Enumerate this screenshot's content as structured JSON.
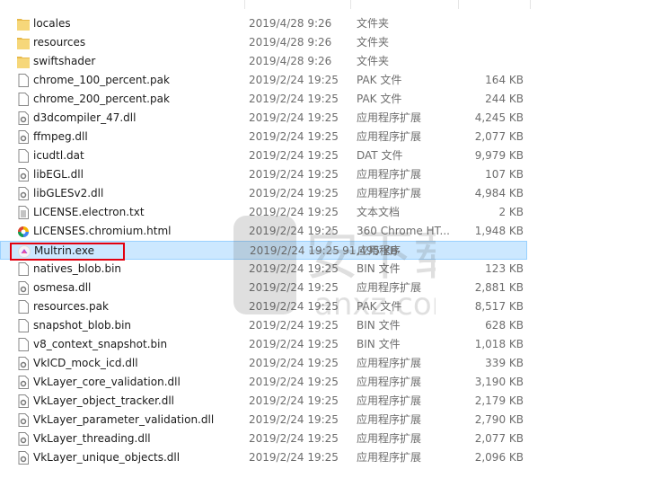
{
  "colors": {
    "selection": "#cce8ff",
    "highlight": "#e3000f",
    "folder": "#f6d77a"
  },
  "files": [
    {
      "name": "locales",
      "date": "2019/4/28 9:26",
      "type": "文件夹",
      "size": "",
      "icon": "folder-icon"
    },
    {
      "name": "resources",
      "date": "2019/4/28 9:26",
      "type": "文件夹",
      "size": "",
      "icon": "folder-icon"
    },
    {
      "name": "swiftshader",
      "date": "2019/4/28 9:26",
      "type": "文件夹",
      "size": "",
      "icon": "folder-icon"
    },
    {
      "name": "chrome_100_percent.pak",
      "date": "2019/2/24 19:25",
      "type": "PAK 文件",
      "size": "164 KB",
      "icon": "file-icon"
    },
    {
      "name": "chrome_200_percent.pak",
      "date": "2019/2/24 19:25",
      "type": "PAK 文件",
      "size": "244 KB",
      "icon": "file-icon"
    },
    {
      "name": "d3dcompiler_47.dll",
      "date": "2019/2/24 19:25",
      "type": "应用程序扩展",
      "size": "4,245 KB",
      "icon": "dll-icon"
    },
    {
      "name": "ffmpeg.dll",
      "date": "2019/2/24 19:25",
      "type": "应用程序扩展",
      "size": "2,077 KB",
      "icon": "dll-icon"
    },
    {
      "name": "icudtl.dat",
      "date": "2019/2/24 19:25",
      "type": "DAT 文件",
      "size": "9,979 KB",
      "icon": "file-icon"
    },
    {
      "name": "libEGL.dll",
      "date": "2019/2/24 19:25",
      "type": "应用程序扩展",
      "size": "107 KB",
      "icon": "dll-icon"
    },
    {
      "name": "libGLESv2.dll",
      "date": "2019/2/24 19:25",
      "type": "应用程序扩展",
      "size": "4,984 KB",
      "icon": "dll-icon"
    },
    {
      "name": "LICENSE.electron.txt",
      "date": "2019/2/24 19:25",
      "type": "文本文档",
      "size": "2 KB",
      "icon": "text-file-icon"
    },
    {
      "name": "LICENSES.chromium.html",
      "date": "2019/2/24 19:25",
      "type": "360 Chrome HT...",
      "size": "1,948 KB",
      "icon": "browser-html-icon"
    },
    {
      "name": "Multrin.exe",
      "date": "2019/2/24 19:25",
      "type": "应用程序",
      "size": "91,495 KB",
      "icon": "app-exe-icon",
      "selected": true
    },
    {
      "name": "natives_blob.bin",
      "date": "2019/2/24 19:25",
      "type": "BIN 文件",
      "size": "123 KB",
      "icon": "file-icon"
    },
    {
      "name": "osmesa.dll",
      "date": "2019/2/24 19:25",
      "type": "应用程序扩展",
      "size": "2,881 KB",
      "icon": "dll-icon"
    },
    {
      "name": "resources.pak",
      "date": "2019/2/24 19:25",
      "type": "PAK 文件",
      "size": "8,517 KB",
      "icon": "file-icon"
    },
    {
      "name": "snapshot_blob.bin",
      "date": "2019/2/24 19:25",
      "type": "BIN 文件",
      "size": "628 KB",
      "icon": "file-icon"
    },
    {
      "name": "v8_context_snapshot.bin",
      "date": "2019/2/24 19:25",
      "type": "BIN 文件",
      "size": "1,018 KB",
      "icon": "file-icon"
    },
    {
      "name": "VkICD_mock_icd.dll",
      "date": "2019/2/24 19:25",
      "type": "应用程序扩展",
      "size": "339 KB",
      "icon": "dll-icon"
    },
    {
      "name": "VkLayer_core_validation.dll",
      "date": "2019/2/24 19:25",
      "type": "应用程序扩展",
      "size": "3,190 KB",
      "icon": "dll-icon"
    },
    {
      "name": "VkLayer_object_tracker.dll",
      "date": "2019/2/24 19:25",
      "type": "应用程序扩展",
      "size": "2,179 KB",
      "icon": "dll-icon"
    },
    {
      "name": "VkLayer_parameter_validation.dll",
      "date": "2019/2/24 19:25",
      "type": "应用程序扩展",
      "size": "2,790 KB",
      "icon": "dll-icon"
    },
    {
      "name": "VkLayer_threading.dll",
      "date": "2019/2/24 19:25",
      "type": "应用程序扩展",
      "size": "2,077 KB",
      "icon": "dll-icon"
    },
    {
      "name": "VkLayer_unique_objects.dll",
      "date": "2019/2/24 19:25",
      "type": "应用程序扩展",
      "size": "2,096 KB",
      "icon": "dll-icon"
    }
  ]
}
